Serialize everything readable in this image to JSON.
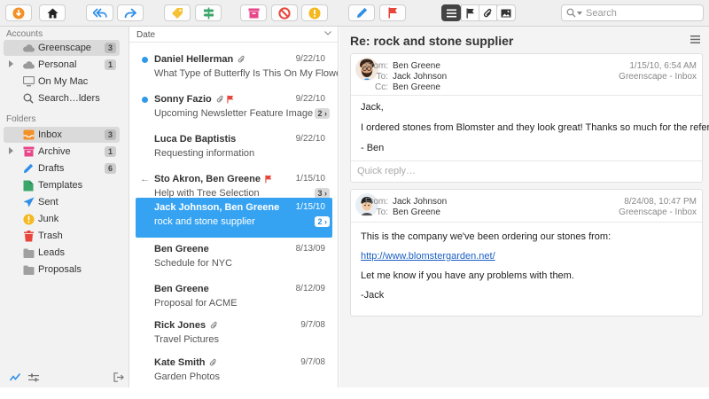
{
  "toolbar": {
    "buttons": [
      {
        "name": "get-mail-button",
        "icon": "download-icon",
        "color": "#f29128"
      },
      {
        "name": "home-button",
        "icon": "home-icon",
        "color": "#222222"
      },
      {
        "name": "reply-all-button",
        "icon": "reply-all-icon",
        "color": "#2f8fe8"
      },
      {
        "name": "forward-button",
        "icon": "forward-icon",
        "color": "#2f8fe8"
      },
      {
        "name": "tag-button",
        "icon": "tag-icon",
        "color": "#f4c233"
      },
      {
        "name": "move-button",
        "icon": "signpost-icon",
        "color": "#3aa66a"
      },
      {
        "name": "archive-button",
        "icon": "archive-icon",
        "color": "#e8468a"
      },
      {
        "name": "block-button",
        "icon": "block-icon",
        "color": "#e8453c"
      },
      {
        "name": "junk-button",
        "icon": "warning-icon",
        "color": "#f4b820"
      },
      {
        "name": "compose-button",
        "icon": "pencil-icon",
        "color": "#2f8fe8"
      },
      {
        "name": "flag-button",
        "icon": "flag-icon",
        "color": "#e8453c"
      },
      {
        "name": "list-view-button",
        "icon": "list-icon",
        "color": "#ffffff"
      },
      {
        "name": "flagged-filter-button",
        "icon": "flag-outline-icon",
        "color": "#333333"
      },
      {
        "name": "attachment-filter-button",
        "icon": "paperclip-icon",
        "color": "#333333"
      },
      {
        "name": "image-filter-button",
        "icon": "image-icon",
        "color": "#333333"
      }
    ],
    "search_placeholder": "Search"
  },
  "sidebar": {
    "accounts_heading": "Accounts",
    "accounts": [
      {
        "label": "Greenscape",
        "count": "3",
        "icon": "cloud-icon",
        "color": "#9a9a9a"
      },
      {
        "label": "Personal",
        "count": "1",
        "icon": "cloud-icon",
        "color": "#9a9a9a"
      },
      {
        "label": "On My Mac",
        "count": "",
        "icon": "monitor-icon",
        "color": "#8a8a8a"
      },
      {
        "label": "Search…lders",
        "count": "",
        "icon": "search-icon",
        "color": "#6a6a6a"
      }
    ],
    "folders_heading": "Folders",
    "folders": [
      {
        "label": "Inbox",
        "count": "3",
        "icon": "inbox-icon",
        "color": "#f29128"
      },
      {
        "label": "Archive",
        "count": "1",
        "icon": "archive-icon",
        "color": "#e8468a"
      },
      {
        "label": "Drafts",
        "count": "6",
        "icon": "pencil-icon",
        "color": "#2f8fe8"
      },
      {
        "label": "Templates",
        "count": "",
        "icon": "templates-icon",
        "color": "#3aa66a"
      },
      {
        "label": "Sent",
        "count": "",
        "icon": "paper-plane-icon",
        "color": "#2f8fe8"
      },
      {
        "label": "Junk",
        "count": "",
        "icon": "warning-icon",
        "color": "#f4b820"
      },
      {
        "label": "Trash",
        "count": "",
        "icon": "trash-icon",
        "color": "#e8453c"
      },
      {
        "label": "Leads",
        "count": "",
        "icon": "folder-icon",
        "color": "#a0a0a0"
      },
      {
        "label": "Proposals",
        "count": "",
        "icon": "folder-icon",
        "color": "#a0a0a0"
      }
    ]
  },
  "list": {
    "sort_label": "Date",
    "messages": [
      {
        "from": "Daniel Hellerman",
        "date": "9/22/10",
        "subject": "What Type of Butterfly Is This On My Flowers?",
        "unread": true,
        "attachment": true,
        "flag": false,
        "replied": false,
        "thread": ""
      },
      {
        "from": "Sonny Fazio",
        "date": "9/22/10",
        "subject": "Upcoming Newsletter Feature Image",
        "unread": true,
        "attachment": true,
        "flag": true,
        "replied": false,
        "thread": "2"
      },
      {
        "from": "Luca De Baptistis",
        "date": "9/22/10",
        "subject": "Requesting information",
        "unread": false,
        "attachment": false,
        "flag": false,
        "replied": false,
        "thread": ""
      },
      {
        "from": "Sto Akron, Ben Greene",
        "date": "1/15/10",
        "subject": "Help with Tree Selection",
        "unread": false,
        "attachment": false,
        "flag": true,
        "replied": true,
        "thread": "3"
      },
      {
        "from": "Jack Johnson, Ben Greene",
        "date": "1/15/10",
        "subject": "rock and stone supplier",
        "unread": false,
        "attachment": false,
        "flag": false,
        "replied": false,
        "thread": "2",
        "selected": true
      },
      {
        "from": "Ben Greene",
        "date": "8/13/09",
        "subject": "Schedule for NYC",
        "unread": false,
        "attachment": false,
        "flag": false,
        "replied": false,
        "thread": ""
      },
      {
        "from": "Ben Greene",
        "date": "8/12/09",
        "subject": "Proposal for ACME",
        "unread": false,
        "attachment": false,
        "flag": false,
        "replied": false,
        "thread": ""
      },
      {
        "from": "Rick Jones",
        "date": "9/7/08",
        "subject": "Travel Pictures",
        "unread": false,
        "attachment": true,
        "flag": false,
        "replied": false,
        "thread": ""
      },
      {
        "from": "Kate Smith",
        "date": "9/7/08",
        "subject": "Garden Photos",
        "unread": false,
        "attachment": true,
        "flag": false,
        "replied": false,
        "thread": ""
      }
    ]
  },
  "reader": {
    "title": "Re: rock and stone supplier",
    "messages": [
      {
        "from_label": "From:",
        "from": "Ben Greene",
        "to_label": "To:",
        "to": "Jack Johnson",
        "cc_label": "Cc:",
        "cc": "Ben Greene",
        "date": "1/15/10, 6:54 AM",
        "account": "Greenscape - Inbox",
        "body": [
          "Jack,",
          "I ordered stones from Blomster and they look great!  Thanks so much for the referral!",
          "- Ben"
        ],
        "quick_reply_placeholder": "Quick reply…"
      },
      {
        "from_label": "From:",
        "from": "Jack Johnson",
        "to_label": "To:",
        "to": "Ben Greene",
        "date": "8/24/08, 10:47 PM",
        "account": "Greenscape - Inbox",
        "body_intro": "This is the company we've been ordering our stones from:",
        "link": "http://www.blomstergarden.net/",
        "body_rest": [
          "Let me know if you have any problems with them.",
          "-Jack"
        ]
      }
    ]
  }
}
